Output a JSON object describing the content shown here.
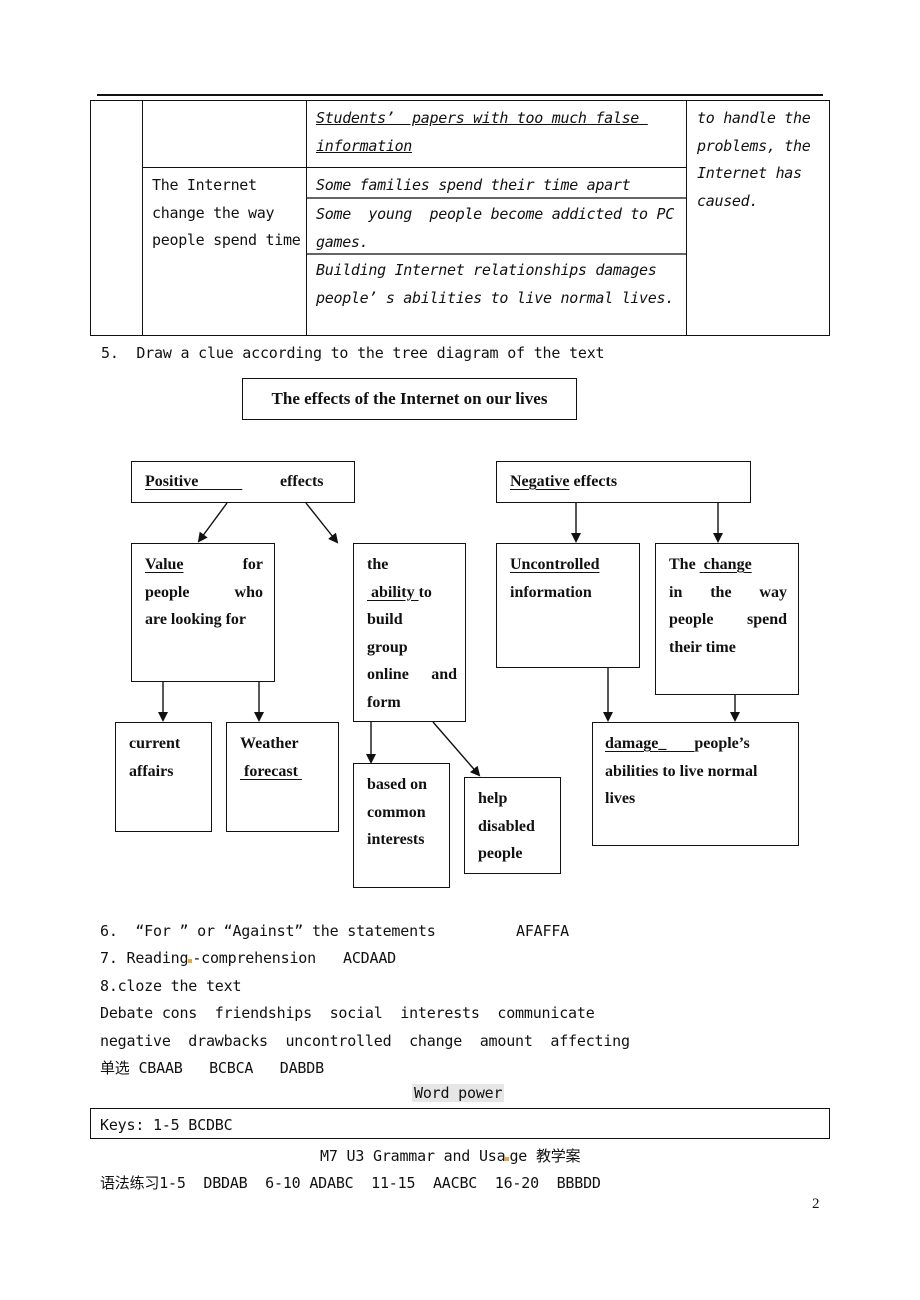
{
  "table": {
    "row_a": {
      "col2": "",
      "col3": "Students’  papers with too much false information"
    },
    "row_b": {
      "col2": "The Internet change the way people spend time",
      "col3_items": [
        "Some families spend their time apart",
        "Some  young  people become addicted to PC games.",
        "Building Internet relationships damages people’ s abilities to live normal lives."
      ]
    },
    "col4": "to handle the problems, the Internet has caused."
  },
  "section5": {
    "heading": "5.  Draw a clue according to the tree diagram of the text"
  },
  "diagram": {
    "root": "The effects of the Internet on our lives",
    "positive": {
      "blank": "Positive",
      "suffix": "effects"
    },
    "negative": {
      "blank": "Negative",
      "suffix": " effects"
    },
    "value_box": {
      "blank": "Value",
      "line1_rest": "for",
      "line2": "people who",
      "line3": "are looking for"
    },
    "ability_box": {
      "line1": "the",
      "blank": "ability",
      "line2_rest": "to",
      "lines": [
        "build",
        "group",
        "online and",
        "form"
      ]
    },
    "uncontrolled_box": {
      "blank": "Uncontrolled",
      "line2": "information"
    },
    "change_box": {
      "prefix": "The ",
      "blank": "change",
      "line2": "in the way",
      "line3": "people spend",
      "line4": "their time"
    },
    "current_box": {
      "line1": "current",
      "line2": "affairs"
    },
    "weather_box": {
      "line1": "Weather",
      "blank": "forecast"
    },
    "common_box": {
      "line1": "based on",
      "line2": "common",
      "line3": "interests"
    },
    "help_box": {
      "line1": "help",
      "line2": "disabled",
      "line3": "people"
    },
    "damage_box": {
      "blank": "damage",
      "rest": "people’s",
      "line2": "abilities to live normal",
      "line3": "lives"
    }
  },
  "answers": {
    "q6_label": "6.  “For ” or “Against” the statements",
    "q6_answer": "AFAFFA",
    "q7_label_a": "7. Reading",
    "q7_label_b": "-comprehension",
    "q7_answer": "ACDAAD",
    "q8_label": "8.cloze the text",
    "cloze_line1": "Debate cons  friendships  social  interests  communicate",
    "cloze_line2": "negative  drawbacks  uncontrolled  change  amount  affecting",
    "single_choice_label": "单选",
    "single_choice_answers": "CBAAB   BCBCA   DABDB"
  },
  "word_power": {
    "title": "Word power",
    "keys": "Keys: 1-5 BCDBC"
  },
  "grammar": {
    "title_a": "M7 U3 Grammar and Usa",
    "title_b": "ge 教学案",
    "label": "语法练习",
    "answers": "1-5  DBDAB  6-10 ADABC  11-15  AACBC  16-20  BBBDD"
  },
  "page_number": "2"
}
